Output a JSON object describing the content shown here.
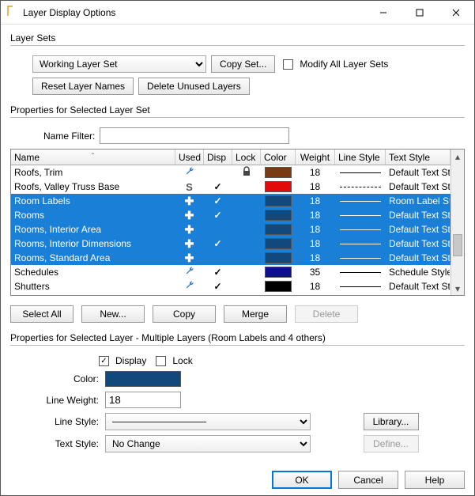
{
  "title": "Layer Display Options",
  "layerSets": {
    "heading": "Layer Sets",
    "current": "Working Layer Set",
    "copySet": "Copy Set...",
    "modifyAll": "Modify All Layer Sets",
    "reset": "Reset Layer Names",
    "deleteUnused": "Delete Unused Layers"
  },
  "propsSet": {
    "heading": "Properties for Selected Layer Set",
    "nameFilterLabel": "Name Filter:",
    "nameFilterValue": ""
  },
  "table": {
    "headers": {
      "name": "Name",
      "used": "Used",
      "disp": "Disp",
      "lock": "Lock",
      "color": "Color",
      "weight": "Weight",
      "lineStyle": "Line Style",
      "textStyle": "Text Style"
    },
    "rows": [
      {
        "name": "Roofs, Trim",
        "usedGlyph": "wrench",
        "disp": false,
        "lock": true,
        "color": "#7a3b12",
        "weight": "18",
        "line": "solid",
        "textStyle": "Default Text Style",
        "selected": false
      },
      {
        "name": "Roofs, Valley Truss Base",
        "usedGlyph": "S",
        "disp": true,
        "lock": false,
        "color": "#e30a0a",
        "weight": "18",
        "line": "dash",
        "textStyle": "Default Text Style",
        "selected": false
      },
      {
        "name": "Room Labels",
        "usedGlyph": "plus",
        "disp": true,
        "lock": false,
        "color": "#12497d",
        "weight": "18",
        "line": "solid",
        "textStyle": "Room Label Style",
        "selected": true
      },
      {
        "name": "Rooms",
        "usedGlyph": "plus",
        "disp": true,
        "lock": false,
        "color": "#12497d",
        "weight": "18",
        "line": "solid",
        "textStyle": "Default Text Style",
        "selected": true
      },
      {
        "name": "Rooms, Interior Area",
        "usedGlyph": "plus",
        "disp": false,
        "lock": false,
        "color": "#12497d",
        "weight": "18",
        "line": "solid",
        "textStyle": "Default Text Style",
        "selected": true
      },
      {
        "name": "Rooms, Interior Dimensions",
        "usedGlyph": "plus",
        "disp": true,
        "lock": false,
        "color": "#12497d",
        "weight": "18",
        "line": "solid",
        "textStyle": "Default Text Style",
        "selected": true
      },
      {
        "name": "Rooms, Standard Area",
        "usedGlyph": "plus",
        "disp": false,
        "lock": false,
        "color": "#12497d",
        "weight": "18",
        "line": "solid",
        "textStyle": "Default Text Style",
        "selected": true
      },
      {
        "name": "Schedules",
        "usedGlyph": "wrench",
        "disp": true,
        "lock": false,
        "color": "#0e0e8e",
        "weight": "35",
        "line": "solid",
        "textStyle": "Schedule Style",
        "selected": false
      },
      {
        "name": "Shutters",
        "usedGlyph": "wrench",
        "disp": true,
        "lock": false,
        "color": "#000000",
        "weight": "18",
        "line": "solid",
        "textStyle": "Default Text Style",
        "selected": false
      }
    ]
  },
  "tableButtons": {
    "selectAll": "Select All",
    "new": "New...",
    "copy": "Copy",
    "merge": "Merge",
    "delete": "Delete"
  },
  "propsLayer": {
    "heading": "Properties for Selected Layer - Multiple Layers (Room Labels and 4 others)",
    "displayLabel": "Display",
    "lockLabel": "Lock",
    "displayChecked": true,
    "lockChecked": false,
    "colorLabel": "Color:",
    "colorValue": "#12497d",
    "lineWeightLabel": "Line Weight:",
    "lineWeightValue": "18",
    "lineStyleLabel": "Line Style:",
    "lineStyleValue": "———",
    "library": "Library...",
    "textStyleLabel": "Text Style:",
    "textStyleValue": "No Change",
    "define": "Define..."
  },
  "footer": {
    "ok": "OK",
    "cancel": "Cancel",
    "help": "Help"
  }
}
